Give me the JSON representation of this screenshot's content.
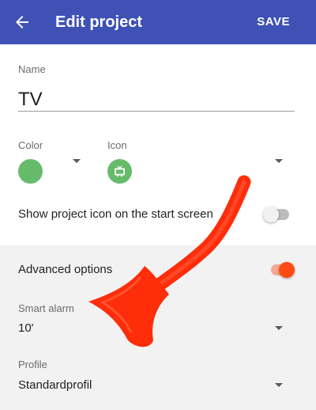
{
  "appbar": {
    "title": "Edit project",
    "save_label": "SAVE",
    "color": "#3f51b5"
  },
  "form": {
    "name_label": "Name",
    "name_value": "TV",
    "color_label": "Color",
    "color_value": "#66bb6a",
    "icon_label": "Icon",
    "icon_name": "tv-icon",
    "show_icon_label": "Show project icon on the start screen",
    "show_icon_enabled": false
  },
  "advanced": {
    "label": "Advanced options",
    "enabled": true,
    "accent": "#ff5722",
    "smart_alarm_label": "Smart alarm",
    "smart_alarm_value": "10'",
    "profile_label": "Profile",
    "profile_value": "Standardprofil"
  }
}
